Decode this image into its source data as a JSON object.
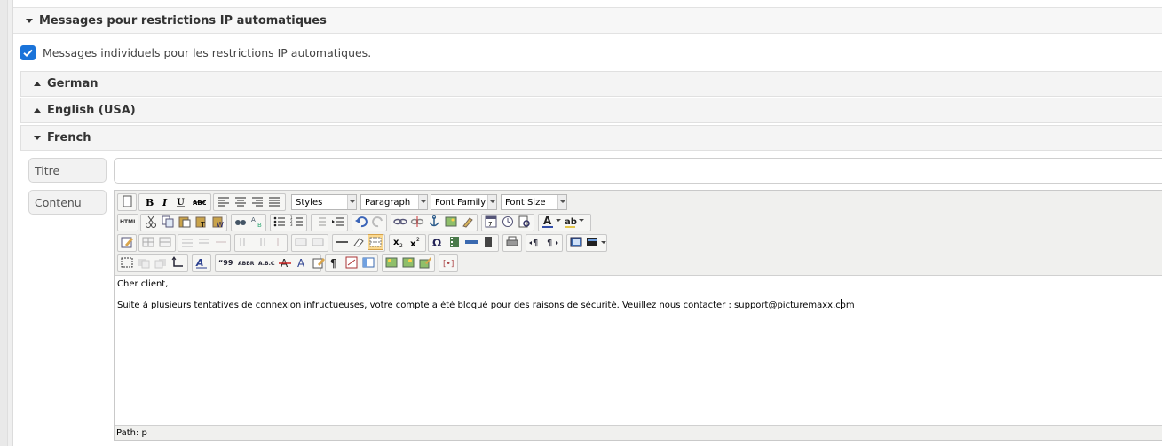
{
  "section": {
    "title": "Messages pour restrictions IP automatiques"
  },
  "individual_messages": {
    "label": "Messages individuels pour les restrictions IP automatiques.",
    "checked": true
  },
  "languages": [
    {
      "label": "German",
      "expanded": false
    },
    {
      "label": "English (USA)",
      "expanded": false
    },
    {
      "label": "French",
      "expanded": true
    }
  ],
  "form": {
    "title_label": "Titre",
    "title_value": "",
    "content_label": "Contenu"
  },
  "editor": {
    "styles_select": "Styles",
    "paragraph_select": "Paragraph",
    "font_family_select": "Font Family",
    "font_size_select": "Font Size",
    "html_button": "HTML",
    "content_line1": "Cher client,",
    "content_line2_before_cursor": "Suite à plusieurs tentatives de connexion infructueuses, votre compte a été bloqué pour des raisons de sécurité. Veuillez nous contacter : support@picturemaxx.c",
    "content_line2_after_cursor": "om",
    "path": "Path: p"
  },
  "colors": {
    "accent": "#1a73d9",
    "header_bg": "#f7f7f7",
    "editor_bg": "#f0f0ee"
  }
}
